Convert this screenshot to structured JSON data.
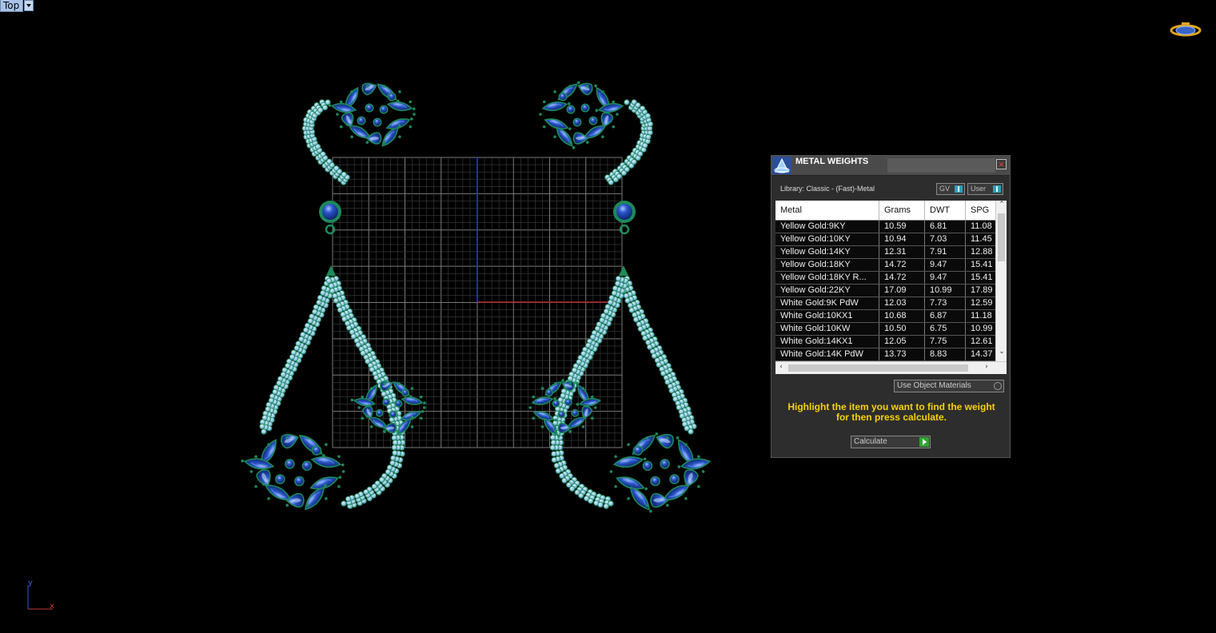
{
  "viewport": {
    "name": "Top",
    "axis_x": "x",
    "axis_y": "y"
  },
  "panel": {
    "title": "METAL WEIGHTS",
    "close": "×",
    "library": "Library: Classic - (Fast)-Metal",
    "toggle_gv": "GV",
    "toggle_user": "User",
    "columns": [
      "Metal",
      "Grams",
      "DWT",
      "SPG"
    ],
    "rows": [
      [
        "Yellow Gold:9KY",
        "10.59",
        "6.81",
        "11.08"
      ],
      [
        "Yellow Gold:10KY",
        "10.94",
        "7.03",
        "11.45"
      ],
      [
        "Yellow Gold:14KY",
        "12.31",
        "7.91",
        "12.88"
      ],
      [
        "Yellow Gold:18KY",
        "14.72",
        "9.47",
        "15.41"
      ],
      [
        "Yellow Gold:18KY R...",
        "14.72",
        "9.47",
        "15.41"
      ],
      [
        "Yellow Gold:22KY",
        "17.09",
        "10.99",
        "17.89"
      ],
      [
        "White Gold:9K PdW",
        "12.03",
        "7.73",
        "12.59"
      ],
      [
        "White Gold:10KX1",
        "10.68",
        "6.87",
        "11.18"
      ],
      [
        "White Gold:10KW",
        "10.50",
        "6.75",
        "10.99"
      ],
      [
        "White Gold:14KX1",
        "12.05",
        "7.75",
        "12.61"
      ],
      [
        "White Gold:14K PdW",
        "13.73",
        "8.83",
        "14.37"
      ]
    ],
    "use_object_materials": "Use Object Materials",
    "hint": "Highlight the item you want to find the weight for then press calculate.",
    "calculate": "Calculate"
  },
  "colors": {
    "background": "#000000",
    "sapphire": "#1b3fa0",
    "diamond": "#8fc6e0",
    "metal": "#1d8a5a",
    "hint": "#f5d20b"
  },
  "icons": [
    "viewport-dropdown-icon",
    "panel-logo-icon",
    "close-icon",
    "toggle-icon",
    "calculate-go-icon",
    "navigation-widget-icon"
  ]
}
